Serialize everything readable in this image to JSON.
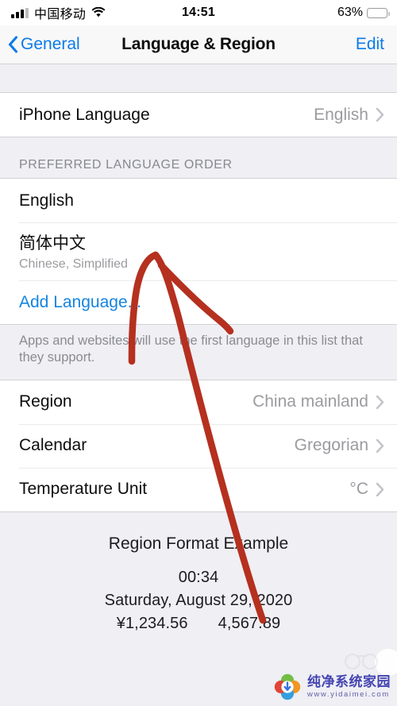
{
  "statusbar": {
    "carrier": "中国移动",
    "time": "14:51",
    "battery_percent": "63%",
    "battery_level": 63,
    "battery_color": "#fcca2f",
    "signal_icon": "signal-bars-icon",
    "wifi_icon": "wifi-icon"
  },
  "navbar": {
    "back_label": "General",
    "title": "Language & Region",
    "edit_label": "Edit",
    "accent_color": "#0b7ae8"
  },
  "language_section": {
    "iphone_language_label": "iPhone Language",
    "iphone_language_value": "English"
  },
  "preferred": {
    "header": "PREFERRED LANGUAGE ORDER",
    "items": [
      {
        "title": "English",
        "subtitle": ""
      },
      {
        "title": "简体中文",
        "subtitle": "Chinese, Simplified"
      }
    ],
    "add_language_label": "Add Language...",
    "footer": "Apps and websites will use the first language in this list that they support."
  },
  "region_section": {
    "rows": [
      {
        "label": "Region",
        "value": "China mainland"
      },
      {
        "label": "Calendar",
        "value": "Gregorian"
      },
      {
        "label": "Temperature Unit",
        "value": "°C"
      }
    ]
  },
  "example": {
    "title": "Region Format Example",
    "time": "00:34",
    "date": "Saturday, August 29, 2020",
    "currency": "¥1,234.56",
    "number": "4,567.89"
  },
  "annotation": {
    "color": "#b5301f",
    "shape": "hand-drawn-arrow-pointing-to-simplified-chinese-row"
  },
  "watermark": {
    "title": "纯净系统家园",
    "url": "www.yidaimei.com"
  }
}
